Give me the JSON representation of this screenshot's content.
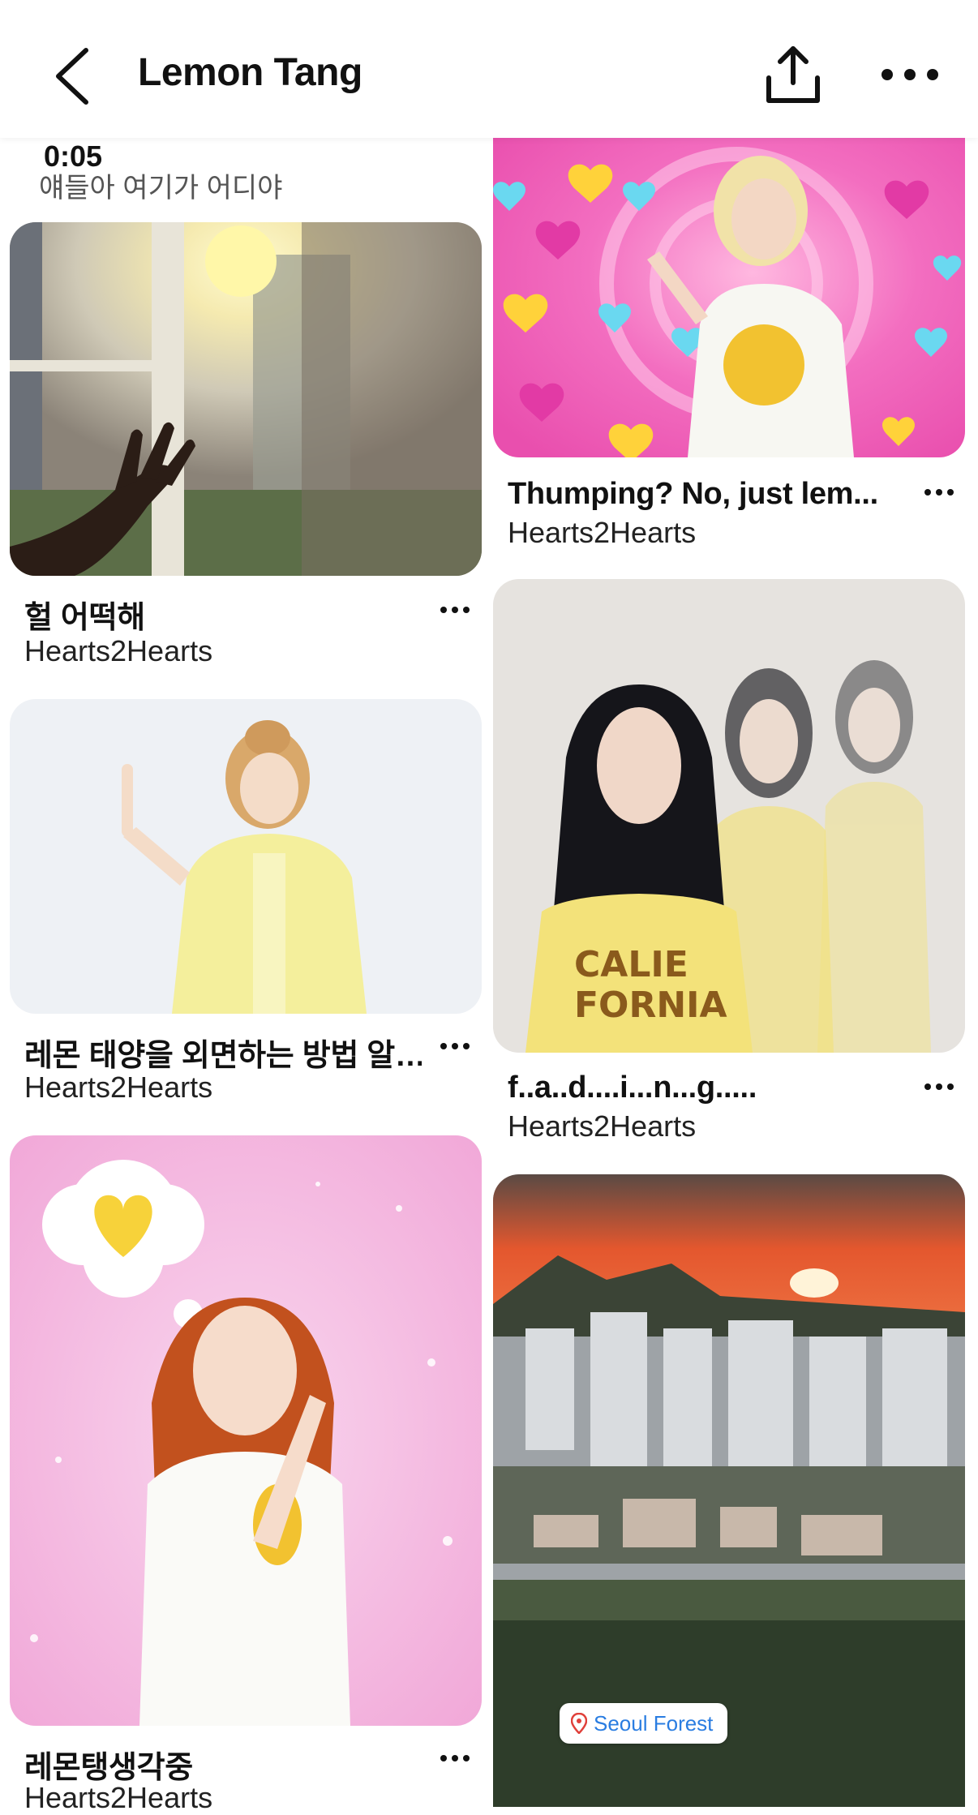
{
  "header": {
    "title": "Lemon Tang",
    "back_icon": "chevron-left-icon",
    "share_icon": "share-upload-icon",
    "more_icon": "more-horizontal-icon"
  },
  "video": {
    "time": "0:05",
    "caption": "얘들아 여기가 어디야"
  },
  "pins": [
    {
      "title": "헐 어떡해",
      "author": "Hearts2Hearts"
    },
    {
      "title": "Thumping? No, just lem...",
      "author": "Hearts2Hearts"
    },
    {
      "title": "레몬 태양을 외면하는 방법 알…",
      "author": "Hearts2Hearts"
    },
    {
      "title": "f..a..d....i...n...g.....",
      "author": "Hearts2Hearts"
    },
    {
      "title": "레몬탱생각중",
      "author": "Hearts2Hearts"
    }
  ],
  "location_tag": {
    "label": "Seoul Forest",
    "icon": "map-pin-icon"
  },
  "colors": {
    "pink_bg": "#f36ec0",
    "sunset": "#e4572e",
    "location_text": "#2a7de1"
  }
}
